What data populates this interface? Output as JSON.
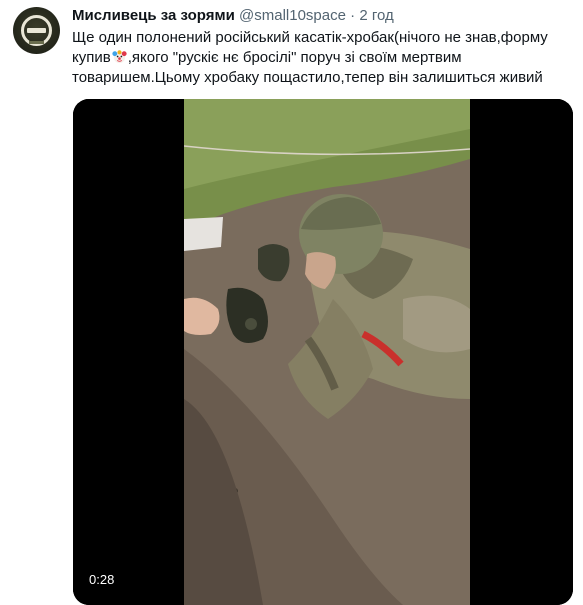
{
  "tweet": {
    "author_name": "Мисливець за зорями",
    "author_handle": "@small10space",
    "separator": "·",
    "timestamp": "2 год",
    "text_lines": [
      "Ще один полонений російський касатік-хробак(нічого не знав,форму",
      "купив",
      ",якого \"рускіє нє бросілі\" поруч зі своїм мертвим",
      "товаришем.Цьому хробаку пощастило,тепер він залишиться живий"
    ],
    "emoji": "clown-face",
    "video": {
      "duration": "0:28"
    }
  },
  "colors": {
    "name": "#0f1419",
    "secondary": "#536471",
    "media_bg": "#000000"
  }
}
